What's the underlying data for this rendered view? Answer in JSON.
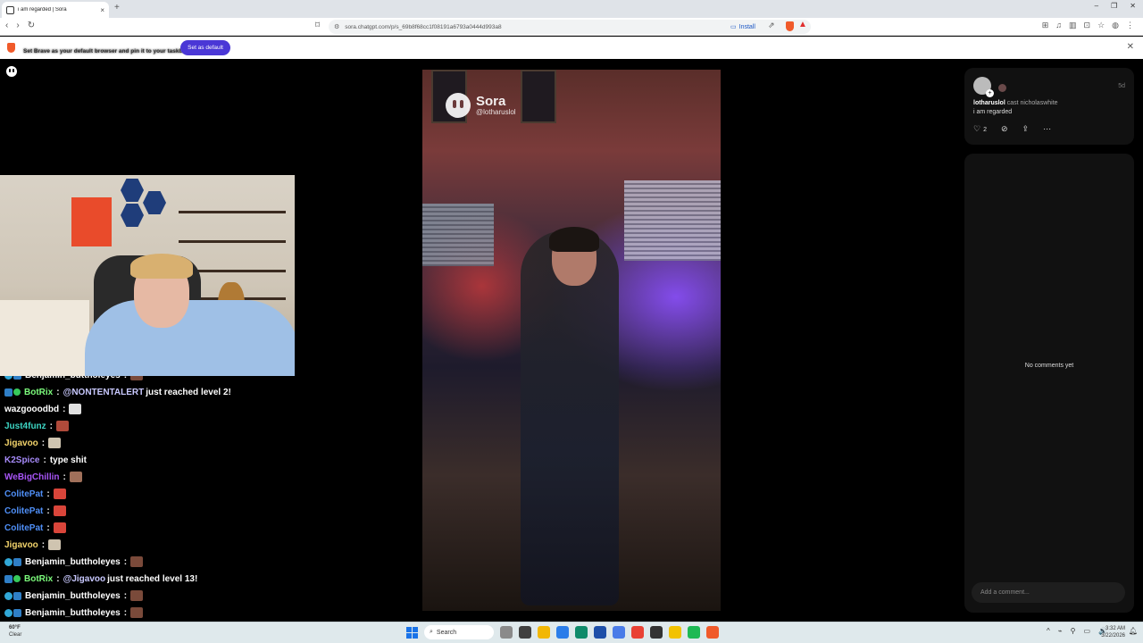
{
  "browser": {
    "tab_title": "i am regarded | Sora",
    "tab_close": "×",
    "new_tab": "+",
    "window_controls": [
      "–",
      "❐",
      "✕"
    ],
    "nav": [
      "‹",
      "›",
      "↻"
    ],
    "url": "sora.chatgpt.com/p/s_69b8f68cc1f08191a6793a0444d993a8",
    "install_label": "Install",
    "toolbar_icons": [
      "⊞",
      "♫",
      "▥",
      "⊡",
      "☆",
      "◍",
      "⋮"
    ]
  },
  "infobar": {
    "message": "Set Brave as your default browser and pin it to your taskbar",
    "button": "Set as default",
    "close": "✕"
  },
  "video": {
    "brand": "Sora",
    "handle": "@lotharuslol"
  },
  "post": {
    "username": "lotharuslol",
    "cast_text": "cast nicholaswhite",
    "caption": "i am regarded",
    "time": "5d",
    "like_count": "2"
  },
  "comments": {
    "empty_text": "No comments yet",
    "placeholder": "Add a comment..."
  },
  "chat": {
    "messages": [
      {
        "user": "Benjamin_buttholeyes",
        "color": "#ffffff",
        "text": "",
        "emote": "#7a4a3a",
        "badges": [
          "b3",
          "b1"
        ]
      },
      {
        "user": "BotRix",
        "color": "#7cfc7c",
        "mention": "@NONTENTALERT",
        "text": "just reached level 2!",
        "badges": [
          "b1",
          "b2"
        ]
      },
      {
        "user": "wazgooodbd",
        "color": "#ffffff",
        "text": "",
        "emote": "#e0e0e0",
        "badges": []
      },
      {
        "user": "Just4funz",
        "color": "#3dd6c4",
        "text": "",
        "emote": "#b04a3a",
        "badges": []
      },
      {
        "user": "Jigavoo",
        "color": "#f2d36b",
        "text": "",
        "emote": "#cfc4b0",
        "badges": []
      },
      {
        "user": "K2Spice",
        "color": "#a78bfa",
        "text": "type shit",
        "badges": []
      },
      {
        "user": "WeBigChillin",
        "color": "#a855f7",
        "text": "",
        "emote": "#a0705a",
        "badges": []
      },
      {
        "user": "ColitePat",
        "color": "#4f8ff7",
        "text": "",
        "emote": "#d9453a",
        "badges": []
      },
      {
        "user": "ColitePat",
        "color": "#4f8ff7",
        "text": "",
        "emote": "#d9453a",
        "badges": []
      },
      {
        "user": "ColitePat",
        "color": "#4f8ff7",
        "text": "",
        "emote": "#d9453a",
        "badges": []
      },
      {
        "user": "Jigavoo",
        "color": "#f2d36b",
        "text": "",
        "emote": "#cfc4b0",
        "badges": []
      },
      {
        "user": "Benjamin_buttholeyes",
        "color": "#ffffff",
        "text": "",
        "emote": "#7a4a3a",
        "badges": [
          "b3",
          "b1"
        ]
      },
      {
        "user": "BotRix",
        "color": "#7cfc7c",
        "mention": "@Jigavoo",
        "text": "just reached level 13!",
        "badges": [
          "b1",
          "b2"
        ]
      },
      {
        "user": "Benjamin_buttholeyes",
        "color": "#ffffff",
        "text": "",
        "emote": "#7a4a3a",
        "badges": [
          "b3",
          "b1"
        ]
      },
      {
        "user": "Benjamin_buttholeyes",
        "color": "#ffffff",
        "text": "",
        "emote": "#7a4a3a",
        "badges": [
          "b3",
          "b1"
        ]
      }
    ]
  },
  "taskbar": {
    "weather_temp": "60°F",
    "weather_desc": "Clear",
    "search_label": "Search",
    "time": "3:32 AM",
    "date": "3/22/2026",
    "apps": [
      "#8a8a8a",
      "#404040",
      "#f2b705",
      "#2b7de9",
      "#0f8a6a",
      "#1e4fa8",
      "#4a7ce8",
      "#e94235",
      "#333333",
      "#f2c200",
      "#1db954",
      "#f05a2a"
    ],
    "tray_icons": [
      "^",
      "⌁",
      "⚲",
      "▭",
      "🔊"
    ]
  }
}
